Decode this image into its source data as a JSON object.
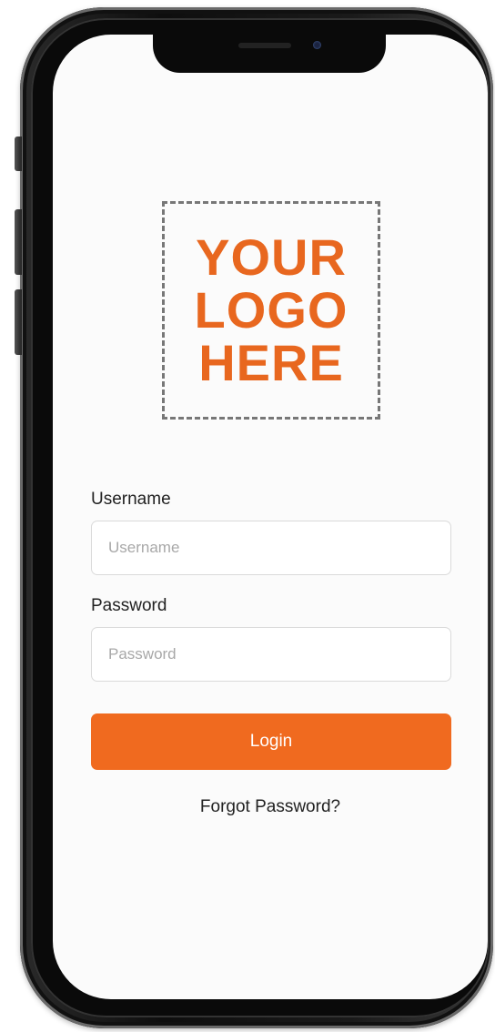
{
  "logo": {
    "lines": [
      "YOUR",
      "LOGO",
      "HERE"
    ],
    "color": "#e8671f"
  },
  "form": {
    "username_label": "Username",
    "username_placeholder": "Username",
    "username_value": "",
    "password_label": "Password",
    "password_placeholder": "Password",
    "password_value": "",
    "login_label": "Login",
    "forgot_label": "Forgot Password?"
  },
  "colors": {
    "accent": "#f06a1f",
    "screen_bg": "#fbfbfb",
    "text": "#222222"
  }
}
